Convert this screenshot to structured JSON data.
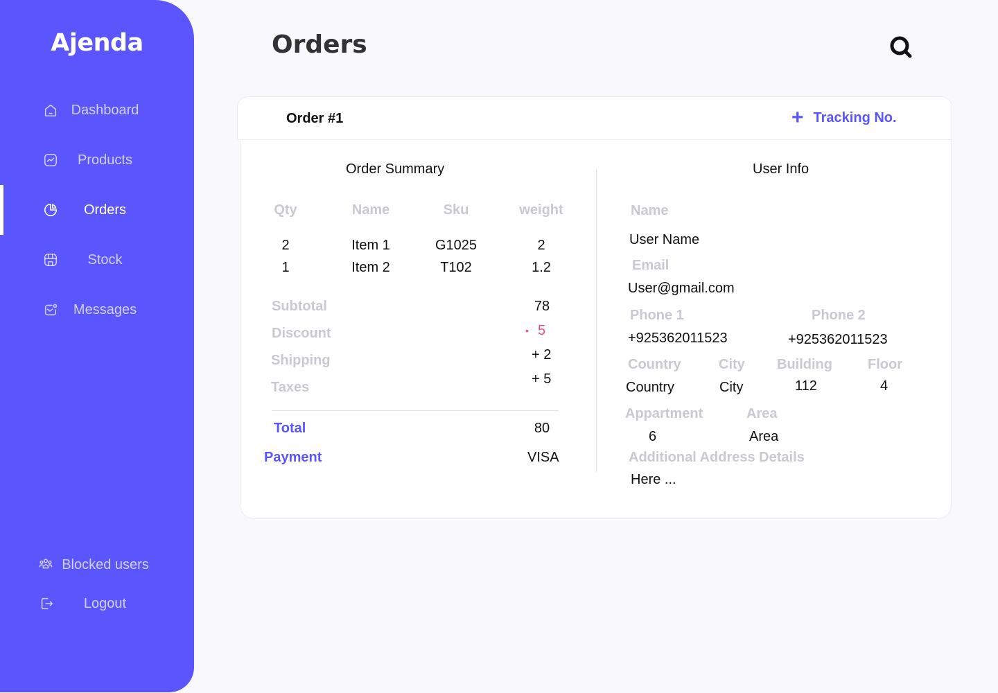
{
  "app": {
    "brand": "Ajenda"
  },
  "sidebar": {
    "items": [
      {
        "label": "Dashboard",
        "icon": "home-icon"
      },
      {
        "label": "Products",
        "icon": "chart-icon"
      },
      {
        "label": "Orders",
        "icon": "pie-icon",
        "active": true
      },
      {
        "label": "Stock",
        "icon": "store-icon"
      },
      {
        "label": "Messages",
        "icon": "message-icon"
      }
    ],
    "bottom": [
      {
        "label": "Blocked users",
        "icon": "users-icon"
      },
      {
        "label": "Logout",
        "icon": "logout-icon"
      }
    ]
  },
  "header": {
    "title": "Orders",
    "search_icon": "search-icon"
  },
  "order": {
    "title": "Order #1",
    "tracking_label": "Tracking No.",
    "tracking_icon": "+"
  },
  "summary": {
    "title": "Order Summary",
    "columns": [
      "Qty",
      "Name",
      "Sku",
      "weight"
    ],
    "rows": [
      {
        "qty": "2",
        "name": "Item 1",
        "sku": "G1025",
        "weight": "2"
      },
      {
        "qty": "1",
        "name": "Item 2",
        "sku": "T102",
        "weight": "1.2"
      }
    ],
    "subtotal_label": "Subtotal",
    "subtotal": "78",
    "discount_label": "Discount",
    "discount_sign": "•",
    "discount": "5",
    "shipping_label": "Shipping",
    "shipping": "+ 2",
    "taxes_label": "Taxes",
    "taxes": "+ 5",
    "total_label": "Total",
    "total": "80",
    "payment_label": "Payment",
    "payment": "VISA"
  },
  "user_info": {
    "title": "User Info",
    "name_label": "Name",
    "name": "User Name",
    "email_label": "Email",
    "email": "User@gmail.com",
    "phone1_label": "Phone 1",
    "phone1": "+925362011523",
    "phone2_label": "Phone 2",
    "phone2": "+925362011523",
    "country_label": "Country",
    "country": "Country",
    "city_label": "City",
    "city": "City",
    "building_label": "Building",
    "building": "112",
    "floor_label": "Floor",
    "floor": "4",
    "apartment_label": "Appartment",
    "apartment": "6",
    "area_label": "Area",
    "area": "Area",
    "details_label": "Additional Address Details",
    "details": "Here ..."
  },
  "colors": {
    "accent": "#5a55fd",
    "discount": "#ec4f8b",
    "muted": "#c9c9d2",
    "background": "#f8f8fd"
  }
}
